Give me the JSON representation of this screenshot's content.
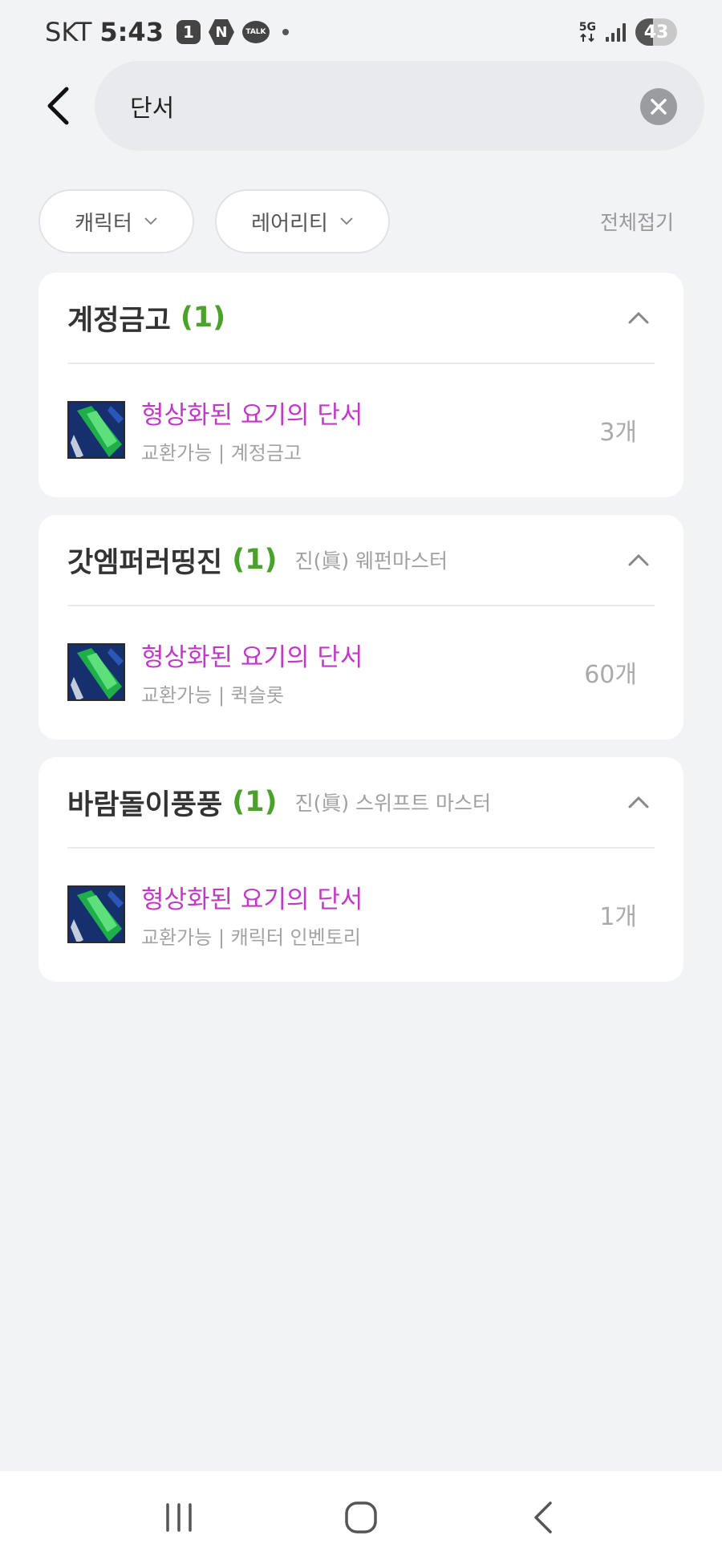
{
  "status_bar": {
    "carrier": "SKT",
    "time": "5:43",
    "notification_badge": "1",
    "naver_badge": "N",
    "talk_badge": "TALK",
    "network": "5G",
    "battery_level": "43",
    "battery_fraction": 0.43
  },
  "search": {
    "query": "단서"
  },
  "filters": {
    "character_label": "캐릭터",
    "rarity_label": "레어리티",
    "collapse_all_label": "전체접기"
  },
  "groups": [
    {
      "title": "계정금고",
      "count": "(1)",
      "subtitle": "",
      "items": [
        {
          "name": "형상화된 요기의 단서",
          "meta": "교환가능 | 계정금고",
          "quantity": "3개",
          "icon": "green-crystal-item-icon"
        }
      ]
    },
    {
      "title": "갓엠퍼러띵진",
      "count": "(1)",
      "subtitle": "진(眞) 웨펀마스터",
      "items": [
        {
          "name": "형상화된 요기의 단서",
          "meta": "교환가능 | 퀵슬롯",
          "quantity": "60개",
          "icon": "green-crystal-item-icon"
        }
      ]
    },
    {
      "title": "바람돌이풍풍",
      "count": "(1)",
      "subtitle": "진(眞) 스위프트 마스터",
      "items": [
        {
          "name": "형상화된 요기의 단서",
          "meta": "교환가능 | 캐릭터 인벤토리",
          "quantity": "1개",
          "icon": "green-crystal-item-icon"
        }
      ]
    }
  ],
  "colors": {
    "background": "#f2f3f5",
    "count_green": "#4aa12b",
    "item_name_purple": "#c13ac7",
    "muted_text": "#a3a3a3"
  },
  "icons": {
    "back": "back-arrow-icon",
    "clear": "clear-x-icon",
    "chevron_down": "chevron-down-icon",
    "chevron_up": "chevron-up-icon",
    "nav_recent": "recent-apps-icon",
    "nav_home": "home-icon",
    "nav_back": "nav-back-icon"
  }
}
